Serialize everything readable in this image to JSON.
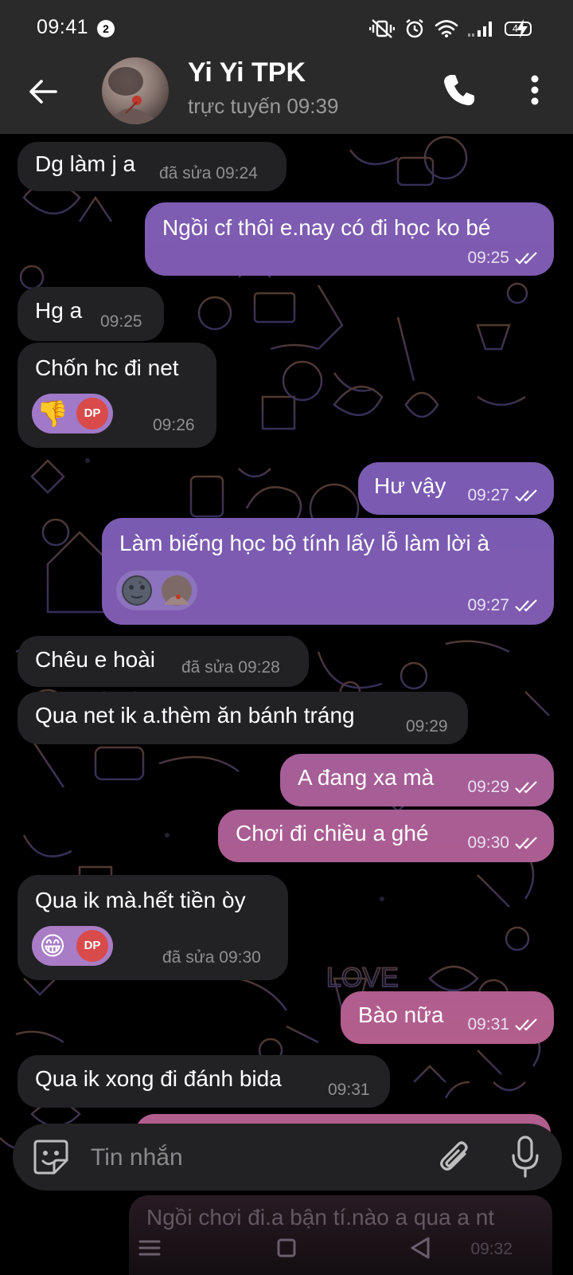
{
  "status_bar": {
    "time": "09:41",
    "notification_count": "2",
    "battery_level": "44"
  },
  "header": {
    "title": "Yi Yi TPK",
    "status": "trực tuyến 09:39"
  },
  "messages": [
    {
      "direction": "in",
      "text": "Dg làm j a",
      "meta": "đã sửa 09:24"
    },
    {
      "direction": "out",
      "text": "Ngồi cf thôi e.nay có đi học ko bé",
      "meta": "09:25"
    },
    {
      "direction": "in",
      "text": "Hg a",
      "meta": "09:25"
    },
    {
      "direction": "in",
      "text": "Chốn hc đi net",
      "meta": "09:26",
      "reactions": [
        "thumbs-down-emoji",
        "DP"
      ]
    },
    {
      "direction": "out",
      "text": "Hư vậy",
      "meta": "09:27"
    },
    {
      "direction": "out",
      "text": "Làm biếng học bộ tính lấy lỗ làm lời à",
      "meta": "09:27",
      "reactions": [
        "new-moon-face-emoji",
        "user-avatar"
      ]
    },
    {
      "direction": "in",
      "text": "Chêu e hoài",
      "meta": "đã sửa 09:28"
    },
    {
      "direction": "in",
      "text": "Qua net ik a.thèm ăn bánh tráng",
      "meta": "09:29"
    },
    {
      "direction": "out",
      "text": "A đang xa mà",
      "meta": "09:29"
    },
    {
      "direction": "out",
      "text": "Chơi đi chiều a ghé",
      "meta": "09:30"
    },
    {
      "direction": "in",
      "text": "Qua ik mà.hết tiền òy",
      "meta": "đã sửa 09:30",
      "reactions": [
        "grinning-face-emoji",
        "DP"
      ]
    },
    {
      "direction": "out",
      "text": "Bào nữa",
      "meta": "09:31"
    },
    {
      "direction": "in",
      "text": "Qua ik xong đi đánh bida",
      "meta": "09:31"
    },
    {
      "direction": "out",
      "text": "Ngồi chơi đi.a bận tí.nào a qua a nt",
      "meta": "09:32"
    }
  ],
  "reaction_labels": {
    "dp": "DP",
    "thumbs_down": "👎",
    "grin": "😁"
  },
  "composer": {
    "placeholder": "Tin nhắn"
  },
  "colors": {
    "outgoing_top": "#7b5cb4",
    "outgoing_bottom": "#b15e8e",
    "incoming": "#222224",
    "header": "#2a2a2a"
  }
}
